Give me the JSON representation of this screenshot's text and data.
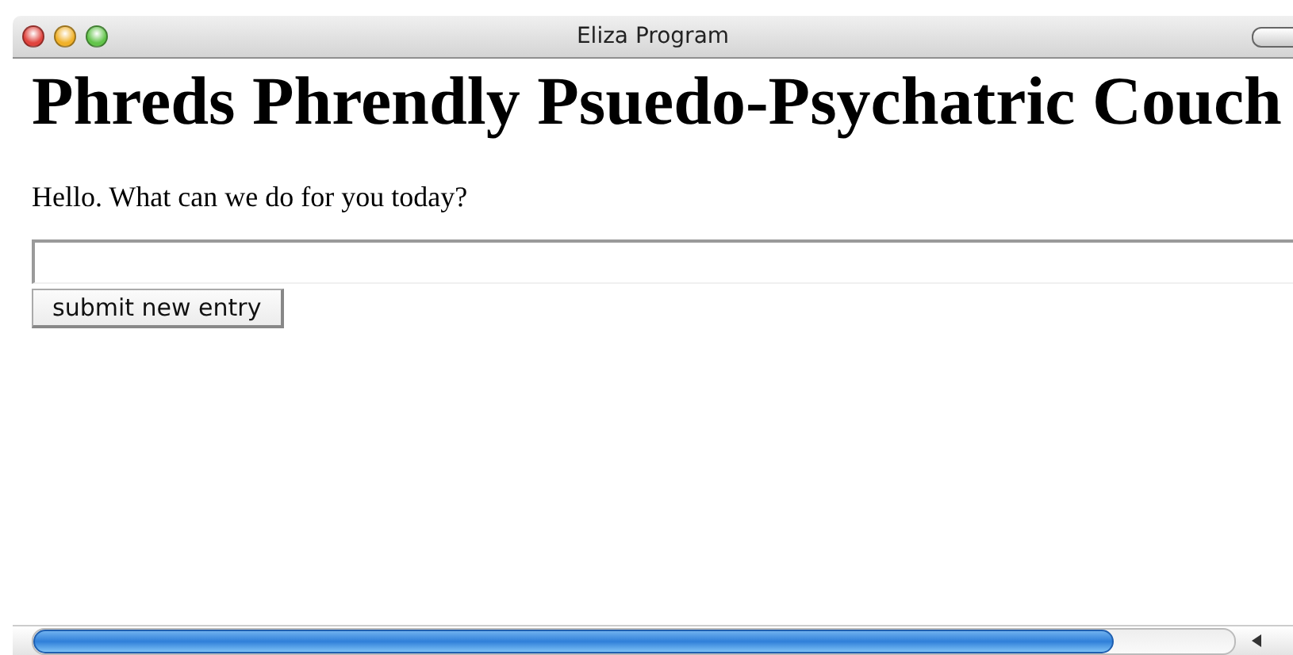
{
  "window": {
    "title": "Eliza Program"
  },
  "heading": "Phreds Phrendly Psuedo-Psychatric Couch",
  "greeting": "Hello. What can we do for you today?",
  "submit_button": "submit new entry",
  "scrollbar": {
    "level": 0.9
  }
}
